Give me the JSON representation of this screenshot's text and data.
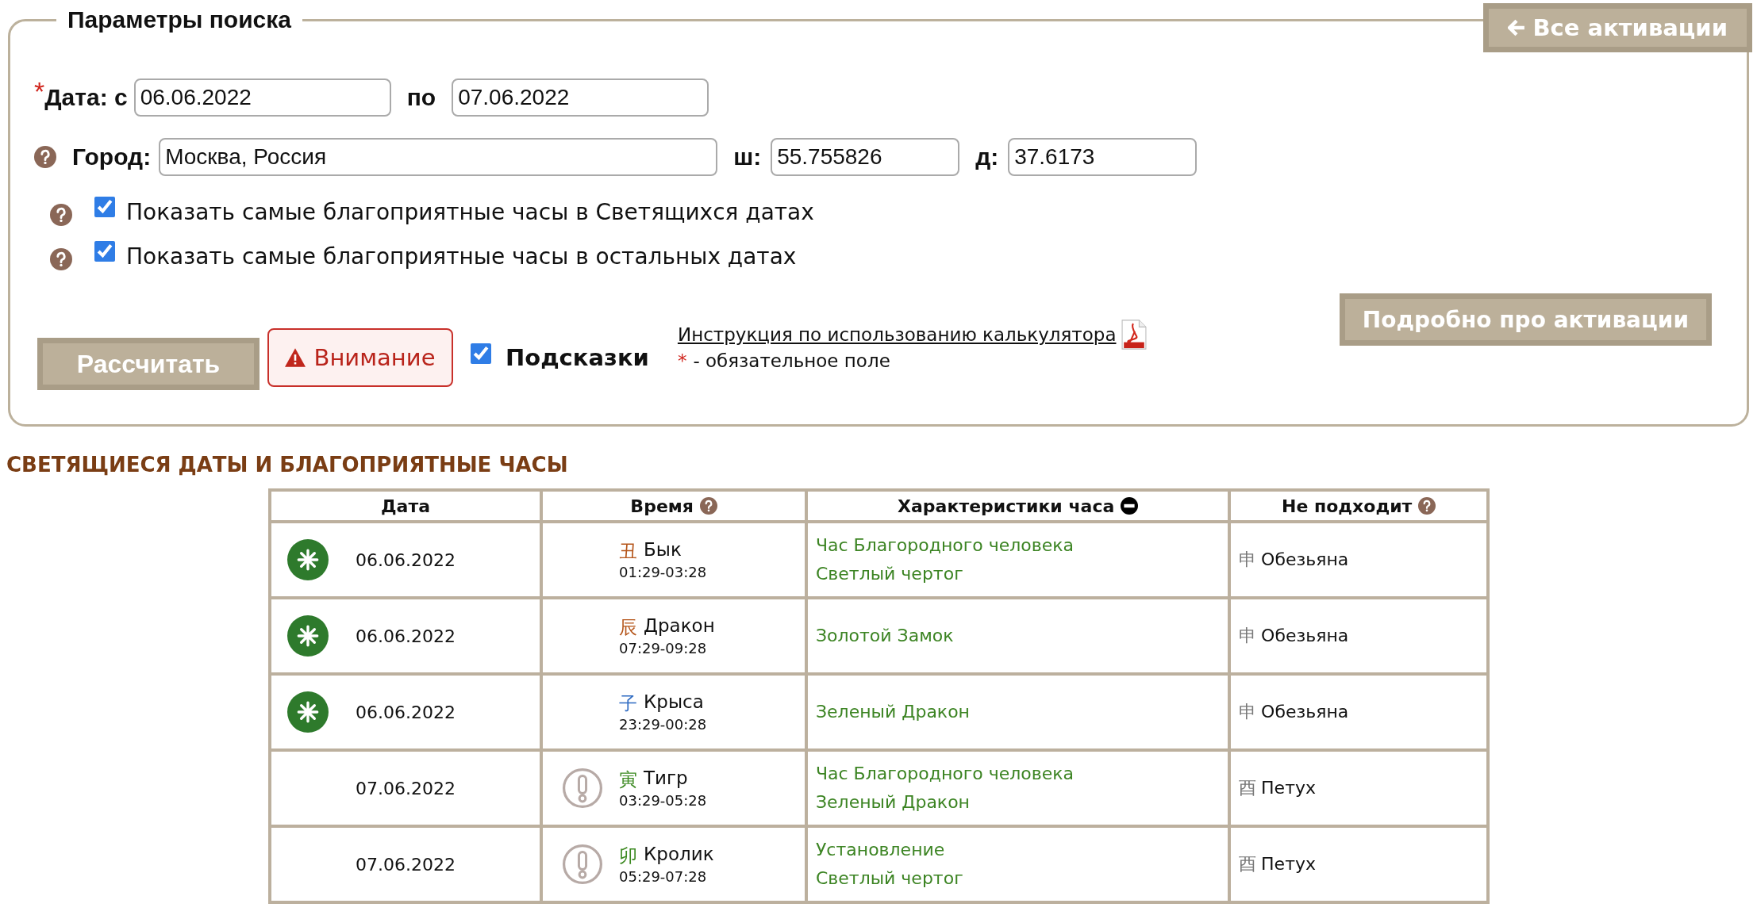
{
  "search_panel": {
    "title": "Параметры поиска",
    "all_activations_button": "Все активации",
    "required_mark": "*",
    "date_label": "Дата: с",
    "date_from": "06.06.2022",
    "to_label": "по",
    "date_to": "07.06.2022",
    "city_label": "Город:",
    "city": "Москва, Россия",
    "lat_label": "ш:",
    "lat": "55.755826",
    "lon_label": "д:",
    "lon": "37.6173",
    "options": [
      {
        "label": "Показать самые благоприятные часы в Светящихся датах",
        "checked": true
      },
      {
        "label": "Показать самые благоприятные часы в остальных датах",
        "checked": true
      }
    ],
    "calculate_button": "Рассчитать",
    "warning_button": "Внимание",
    "hints": {
      "label": "Подсказки",
      "checked": true
    },
    "instructions_link": "Инструкция по использованию калькулятора",
    "required_note_mark": "*",
    "required_note": "- обязательное поле",
    "details_button": "Подробно про активации"
  },
  "results": {
    "title": "СВЕТЯЩИЕСЯ ДАТЫ И БЛАГОПРИЯТНЫЕ ЧАСЫ",
    "columns": [
      {
        "label": "Дата",
        "kind": "plain"
      },
      {
        "label": "Время",
        "kind": "help"
      },
      {
        "label": "Характеристики часа",
        "kind": "collapsible"
      },
      {
        "label": "Не подходит",
        "kind": "help"
      }
    ],
    "rows": [
      {
        "kind": "lucky",
        "date": "06.06.2022",
        "branch": "丑",
        "color": "#b5561b",
        "animal": "Бык",
        "time": "01:29-03:28",
        "traits": [
          "Час Благородного человека",
          "Светлый чертог"
        ],
        "conflict_branch": "申",
        "conflict": "Обезьяна"
      },
      {
        "kind": "lucky",
        "date": "06.06.2022",
        "branch": "辰",
        "color": "#b5561b",
        "animal": "Дракон",
        "time": "07:29-09:28",
        "traits": [
          "Золотой Замок"
        ],
        "conflict_branch": "申",
        "conflict": "Обезьяна"
      },
      {
        "kind": "lucky",
        "date": "06.06.2022",
        "branch": "子",
        "color": "#2f6bc2",
        "animal": "Крыса",
        "time": "23:29-00:28",
        "traits": [
          "Зеленый Дракон"
        ],
        "conflict_branch": "申",
        "conflict": "Обезьяна"
      },
      {
        "kind": "caution",
        "date": "07.06.2022",
        "branch": "寅",
        "color": "#3d8a22",
        "animal": "Тигр",
        "time": "03:29-05:28",
        "traits": [
          "Час Благородного человека",
          "Зеленый Дракон"
        ],
        "conflict_branch": "酉",
        "conflict": "Петух"
      },
      {
        "kind": "caution",
        "date": "07.06.2022",
        "branch": "卯",
        "color": "#3d8a22",
        "animal": "Кролик",
        "time": "05:29-07:28",
        "traits": [
          "Установление",
          "Светлый чертог"
        ],
        "conflict_branch": "酉",
        "conflict": "Петух"
      }
    ]
  }
}
